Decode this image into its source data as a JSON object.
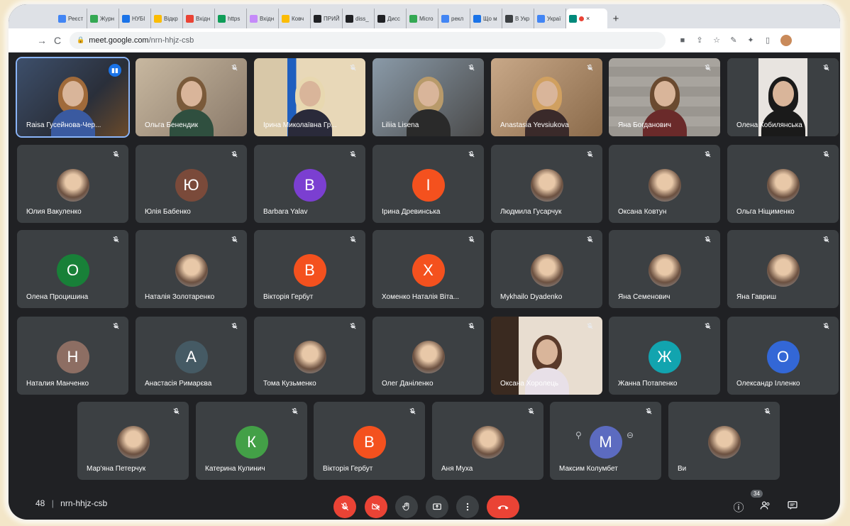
{
  "browser": {
    "tabs": [
      {
        "label": "Реєст",
        "color": "#4285f4"
      },
      {
        "label": "Журн",
        "color": "#34a853"
      },
      {
        "label": "НУБІ",
        "color": "#1a73e8"
      },
      {
        "label": "Відкр",
        "color": "#fbbc04"
      },
      {
        "label": "Вхідн",
        "color": "#ea4335"
      },
      {
        "label": "https",
        "color": "#0f9d58"
      },
      {
        "label": "Вхідн",
        "color": "#c58af9"
      },
      {
        "label": "Ковч",
        "color": "#fbbc04"
      },
      {
        "label": "ПРИЙ",
        "color": "#202124"
      },
      {
        "label": "diss_",
        "color": "#202124"
      },
      {
        "label": "Дисс",
        "color": "#202124"
      },
      {
        "label": "Micro",
        "color": "#34a853"
      },
      {
        "label": "рекл",
        "color": "#4285f4"
      },
      {
        "label": "Що м",
        "color": "#1a73e8"
      },
      {
        "label": "В Укр",
        "color": "#3c4043"
      },
      {
        "label": "Украї",
        "color": "#4285f4"
      }
    ],
    "active_tab_close": "×",
    "new_tab": "+",
    "url_domain": "meet.google.com",
    "url_path": "/nrn-hhjz-csb",
    "back": "←",
    "forward": "→",
    "reload": "C"
  },
  "participants": [
    {
      "name": "Raisa Гусейнова-Чер...",
      "initial": "",
      "color": "",
      "kind": "video",
      "speaking": true,
      "col": 0,
      "row": 0
    },
    {
      "name": "Ольга Бенендик",
      "initial": "",
      "color": "",
      "kind": "video",
      "col": 1,
      "row": 0
    },
    {
      "name": "Ірина Миколаївна Гр...",
      "initial": "",
      "color": "",
      "kind": "video",
      "col": 2,
      "row": 0
    },
    {
      "name": "Liliia Lisena",
      "initial": "",
      "color": "",
      "kind": "video",
      "col": 3,
      "row": 0
    },
    {
      "name": "Anastasia Yevsiukova",
      "initial": "",
      "color": "",
      "kind": "video",
      "col": 4,
      "row": 0
    },
    {
      "name": "Яна Богданович",
      "initial": "",
      "color": "",
      "kind": "video",
      "col": 5,
      "row": 0
    },
    {
      "name": "Олена Кобилянська",
      "initial": "",
      "color": "",
      "kind": "video",
      "col": 6,
      "row": 0
    },
    {
      "name": "Юлия Вакуленко",
      "initial": "",
      "color": "",
      "kind": "photo",
      "col": 0,
      "row": 1
    },
    {
      "name": "Юлія Бабенко",
      "initial": "Ю",
      "color": "#7a4a3a",
      "kind": "letter",
      "col": 1,
      "row": 1
    },
    {
      "name": "Barbara Yalav",
      "initial": "B",
      "color": "#7b3fd1",
      "kind": "letter",
      "col": 2,
      "row": 1
    },
    {
      "name": "Ірина Древинська",
      "initial": "І",
      "color": "#f4511e",
      "kind": "letter",
      "col": 3,
      "row": 1
    },
    {
      "name": "Людмила Гусарчук",
      "initial": "",
      "color": "",
      "kind": "photo",
      "col": 4,
      "row": 1
    },
    {
      "name": "Оксана Ковтун",
      "initial": "",
      "color": "",
      "kind": "photo",
      "col": 5,
      "row": 1
    },
    {
      "name": "Ольга Ніщименко",
      "initial": "",
      "color": "",
      "kind": "photo",
      "col": 6,
      "row": 1
    },
    {
      "name": "Олена Процишина",
      "initial": "О",
      "color": "#188038",
      "kind": "letter",
      "col": 0,
      "row": 2
    },
    {
      "name": "Наталія Золотаренко",
      "initial": "",
      "color": "",
      "kind": "photo",
      "col": 1,
      "row": 2
    },
    {
      "name": "Вікторія Гербут",
      "initial": "В",
      "color": "#f4511e",
      "kind": "letter",
      "col": 2,
      "row": 2
    },
    {
      "name": "Хоменко Наталія Віта...",
      "initial": "Х",
      "color": "#f4511e",
      "kind": "letter",
      "col": 3,
      "row": 2
    },
    {
      "name": "Mykhailo Dyadenko",
      "initial": "",
      "color": "",
      "kind": "photo",
      "col": 4,
      "row": 2
    },
    {
      "name": "Яна Семенович",
      "initial": "",
      "color": "",
      "kind": "photo",
      "col": 5,
      "row": 2
    },
    {
      "name": "Яна Гавриш",
      "initial": "",
      "color": "",
      "kind": "photo",
      "col": 6,
      "row": 2
    },
    {
      "name": "Наталия Манченко",
      "initial": "Н",
      "color": "#8d6e63",
      "kind": "letter",
      "col": 0,
      "row": 3
    },
    {
      "name": "Анастасія Римарєва",
      "initial": "А",
      "color": "#455a64",
      "kind": "letter",
      "col": 1,
      "row": 3
    },
    {
      "name": "Тома Кузьменко",
      "initial": "",
      "color": "",
      "kind": "photo",
      "col": 2,
      "row": 3
    },
    {
      "name": "Олег Даніленко",
      "initial": "",
      "color": "",
      "kind": "photo",
      "col": 3,
      "row": 3
    },
    {
      "name": "Оксана Хоролець",
      "initial": "",
      "color": "",
      "kind": "video",
      "col": 4,
      "row": 3
    },
    {
      "name": "Жанна Потапенко",
      "initial": "Ж",
      "color": "#12a4af",
      "kind": "letter",
      "col": 5,
      "row": 3
    },
    {
      "name": "Олександр Ілленко",
      "initial": "О",
      "color": "#3367d6",
      "kind": "letter",
      "col": 6,
      "row": 3
    },
    {
      "name": "Мар'яна Петерчук",
      "initial": "",
      "color": "",
      "kind": "photo",
      "col": 0,
      "row": 4
    },
    {
      "name": "Катерина Кулинич",
      "initial": "К",
      "color": "#43a047",
      "kind": "letter",
      "col": 1,
      "row": 4
    },
    {
      "name": "Вікторія Гербут",
      "initial": "В",
      "color": "#f4511e",
      "kind": "letter",
      "col": 2,
      "row": 4
    },
    {
      "name": "Аня Муха",
      "initial": "",
      "color": "",
      "kind": "photo",
      "col": 3,
      "row": 4
    },
    {
      "name": "Максим Колумбет",
      "initial": "M",
      "color": "#5c6bc0",
      "kind": "letter",
      "hover": true,
      "col": 4,
      "row": 4
    },
    {
      "name": "Ви",
      "initial": "",
      "color": "",
      "kind": "photo",
      "col": 5,
      "row": 4
    }
  ],
  "bottom": {
    "time_fragment": "48",
    "separator": "|",
    "meeting_code": "nrn-hhjz-csb",
    "people_count": "34"
  },
  "icons": {
    "mic_off": "mic-off-icon",
    "cam_off": "camera-off-icon",
    "raise_hand": "hand-icon",
    "present": "present-icon",
    "more": "more-vert-icon",
    "end_call": "call-end-icon",
    "info": "info-icon",
    "people": "people-icon",
    "chat": "chat-icon"
  },
  "colors": {
    "meet_bg": "#202124",
    "tile_bg": "#3c4043",
    "danger": "#ea4335",
    "speaking": "#8ab4f8"
  }
}
